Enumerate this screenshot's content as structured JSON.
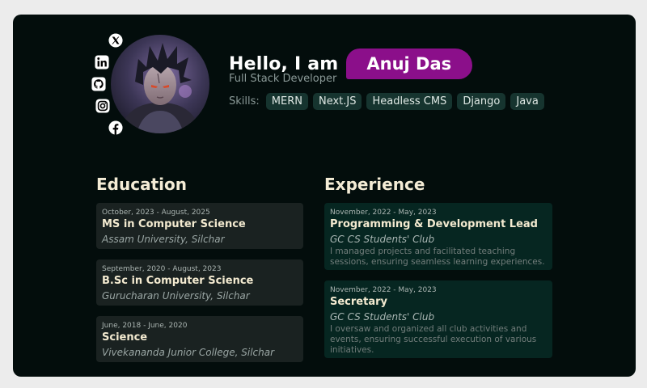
{
  "colors": {
    "page_background": "#ececec",
    "card_background": "#030d0c",
    "name_pill": "#8b0f8a",
    "skill_chip": "#16342f",
    "heading": "#f4ecd6",
    "education_card": "#1a2221",
    "experience_card": "#062621"
  },
  "social": [
    {
      "icon": "x-twitter-icon"
    },
    {
      "icon": "linkedin-icon"
    },
    {
      "icon": "github-icon"
    },
    {
      "icon": "instagram-icon"
    },
    {
      "icon": "facebook-icon"
    }
  ],
  "avatar": {
    "icon": "profile-avatar"
  },
  "hero": {
    "greeting": "Hello, I am",
    "name": "Anuj Das",
    "role": "Full Stack Developer",
    "skills_label": "Skills:",
    "skills": [
      "MERN",
      "Next.JS",
      "Headless CMS",
      "Django",
      "Java"
    ]
  },
  "education": {
    "heading": "Education",
    "items": [
      {
        "dates": "October, 2023 - August, 2025",
        "title": "MS in Computer Science",
        "org": "Assam University, Silchar"
      },
      {
        "dates": "September, 2020 - August, 2023",
        "title": "B.Sc in Computer Science",
        "org": "Gurucharan University, Silchar"
      },
      {
        "dates": "June, 2018 - June, 2020",
        "title": "Science",
        "org": "Vivekananda Junior College, Silchar"
      }
    ]
  },
  "experience": {
    "heading": "Experience",
    "items": [
      {
        "dates": "November, 2022 - May, 2023",
        "title": "Programming & Development Lead",
        "org": "GC CS Students' Club",
        "description": "I managed projects and facilitated teaching sessions, ensuring  seamless learning experiences."
      },
      {
        "dates": "November, 2022 - May, 2023",
        "title": "Secretary",
        "org": "GC CS Students' Club",
        "description": "I oversaw and organized all club activities and events, ensuring  successful execution of various initiatives."
      }
    ]
  }
}
